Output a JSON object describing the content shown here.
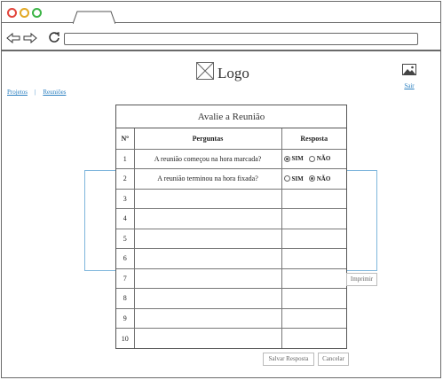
{
  "header": {
    "logo_text": "Logo",
    "logout_label": "Sair"
  },
  "breadcrumb": {
    "projects": "Projetos",
    "separator": "|",
    "meetings": "Reuniões"
  },
  "form": {
    "title": "Avalie a Reunião",
    "columns": {
      "number": "Nº",
      "questions": "Perguntas",
      "answer": "Resposta"
    },
    "yes_label": "SIM",
    "no_label": "NÃO",
    "rows": [
      {
        "n": "1",
        "question": "A reunião começou na hora marcada?",
        "answer": "SIM"
      },
      {
        "n": "2",
        "question": "A reunião terminou na hora fixada?",
        "answer": "NÃO"
      },
      {
        "n": "3",
        "question": ""
      },
      {
        "n": "4",
        "question": ""
      },
      {
        "n": "5",
        "question": ""
      },
      {
        "n": "6",
        "question": ""
      },
      {
        "n": "7",
        "question": ""
      },
      {
        "n": "8",
        "question": ""
      },
      {
        "n": "9",
        "question": ""
      },
      {
        "n": "10",
        "question": ""
      }
    ]
  },
  "buttons": {
    "print": "Imprimir",
    "save": "Salvar Resposta",
    "cancel": "Cancelar"
  },
  "colors": {
    "link": "#2a7fc0",
    "panel_border": "#7fb6dc",
    "dot_red": "#e2453c",
    "dot_yellow": "#e2a824",
    "dot_green": "#3bb446"
  }
}
